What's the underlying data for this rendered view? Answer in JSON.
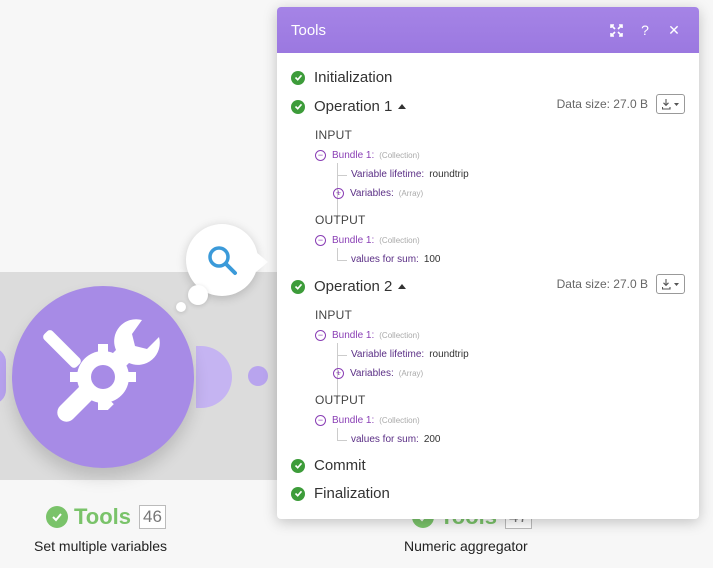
{
  "panel": {
    "title": "Tools",
    "buttons": {
      "expand": "expand-icon",
      "help": "?",
      "close": "✕"
    }
  },
  "stages": {
    "initialization": "Initialization",
    "commit": "Commit",
    "finalization": "Finalization"
  },
  "operations": [
    {
      "label": "Operation 1",
      "data_size": "Data size: 27.0 B",
      "input_label": "INPUT",
      "output_label": "OUTPUT",
      "input": {
        "bundle": "Bundle 1:",
        "bundle_type": "(Collection)",
        "lifetime_key": "Variable lifetime:",
        "lifetime_val": "roundtrip",
        "variables_key": "Variables:",
        "variables_type": "(Array)"
      },
      "output": {
        "bundle": "Bundle 1:",
        "bundle_type": "(Collection)",
        "sum_key": "values for sum:",
        "sum_val": "100"
      }
    },
    {
      "label": "Operation 2",
      "data_size": "Data size: 27.0 B",
      "input_label": "INPUT",
      "output_label": "OUTPUT",
      "input": {
        "bundle": "Bundle 1:",
        "bundle_type": "(Collection)",
        "lifetime_key": "Variable lifetime:",
        "lifetime_val": "roundtrip",
        "variables_key": "Variables:",
        "variables_type": "(Array)"
      },
      "output": {
        "bundle": "Bundle 1:",
        "bundle_type": "(Collection)",
        "sum_key": "values for sum:",
        "sum_val": "200"
      }
    }
  ],
  "modules": [
    {
      "name": "Tools",
      "count": "46",
      "subtitle": "Set multiple variables"
    },
    {
      "name": "Tools",
      "count": "47",
      "subtitle": "Numeric aggregator"
    }
  ],
  "colors": {
    "accent": "#9b78e0",
    "success": "#3d9c3a",
    "module": "#a78be6",
    "tree": "#8a3fb5"
  }
}
